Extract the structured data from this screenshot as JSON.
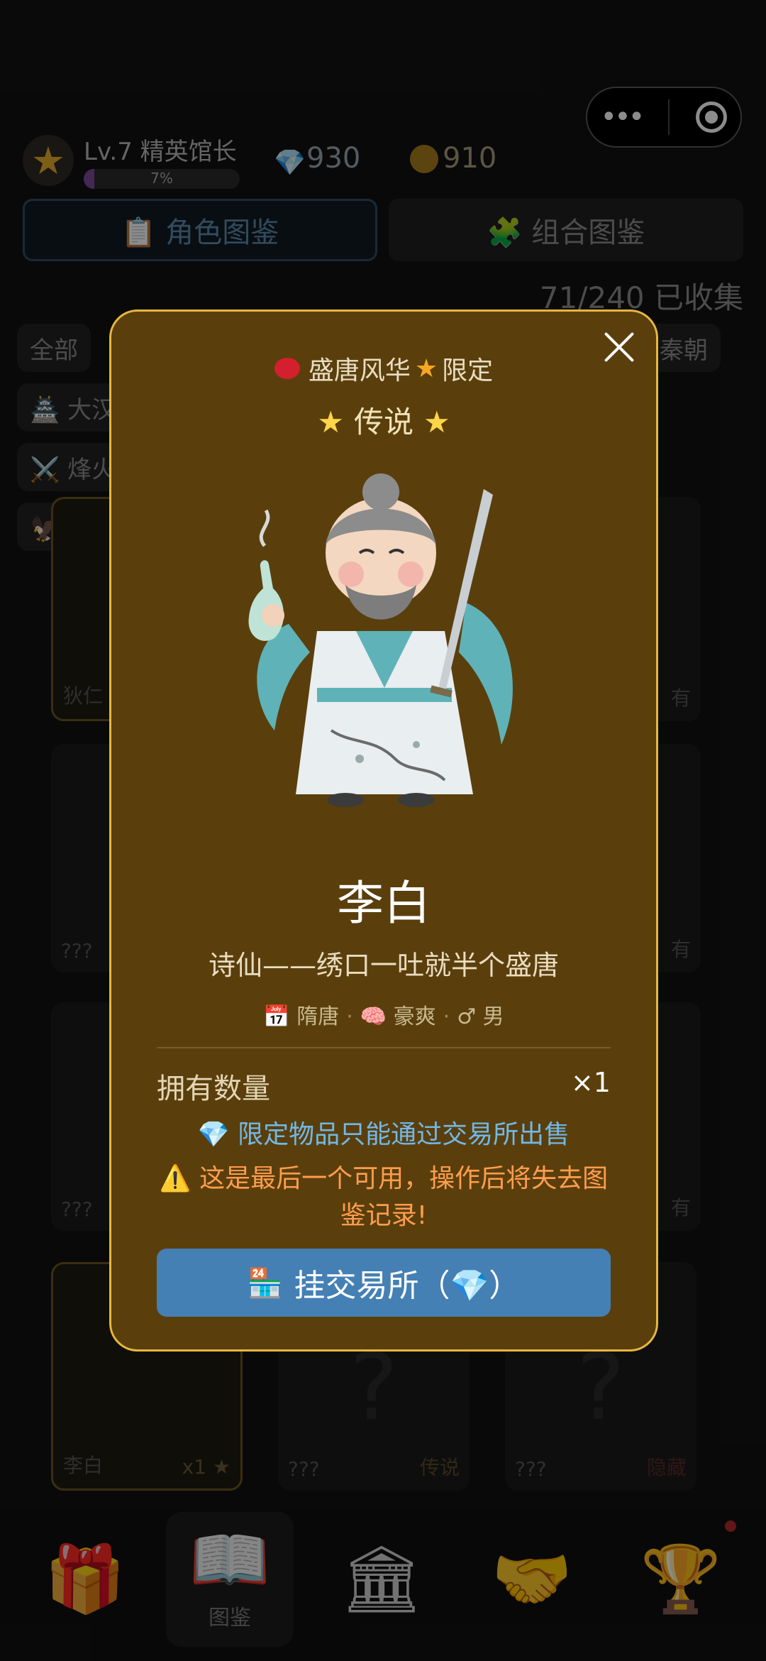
{
  "header": {
    "level_label": "Lv.7 精英馆长",
    "xp_percent": 7,
    "xp_text": "7%",
    "gems": "930",
    "coins": "910"
  },
  "tabs": [
    {
      "label": "📋 角色图鉴",
      "active": true
    },
    {
      "label": "🧩 组合图鉴",
      "active": false
    }
  ],
  "collected": "71/240 已收集",
  "filters": [
    "全部",
    "🏯 大汉",
    "⚔️ 烽火",
    "🦅 枭雄",
    "秦朝"
  ],
  "cards": [
    {
      "label": "狄仁",
      "right": "有"
    },
    {
      "label": "???",
      "right": "有"
    },
    {
      "label": "???",
      "right": "有"
    },
    {
      "label": "李白",
      "right": "x1 ★"
    },
    {
      "label": "???",
      "right": "传说"
    },
    {
      "label": "???",
      "right": "隐藏"
    }
  ],
  "bottom_nav": [
    {
      "icon": "🎁",
      "label": ""
    },
    {
      "icon": "📖",
      "label": "图鉴"
    },
    {
      "icon": "🏛",
      "label": ""
    },
    {
      "icon": "🤝",
      "label": ""
    },
    {
      "icon": "🏆",
      "label": ""
    }
  ],
  "modal": {
    "era_tag": "盛唐风华",
    "limited_tag": "限定",
    "rarity": "传说",
    "name": "李白",
    "motto": "诗仙——绣口一吐就半个盛唐",
    "meta_dynasty": "📅 隋唐",
    "meta_personality": "🧠 豪爽",
    "meta_gender": "♂ 男",
    "owned_label": "拥有数量",
    "owned_value": "×1",
    "limited_note": "💎 限定物品只能通过交易所出售",
    "warning": "⚠️ 这是最后一个可用，操作后将失去图鉴记录!",
    "cta_icon": "🏪",
    "cta_label": "挂交易所（💎）"
  },
  "colors": {
    "modal_bg": "#5a3f0d",
    "modal_border": "#e7b73f",
    "cta_bg": "#4580b4",
    "rarity": "#ffd54a",
    "warning": "#ff9d4d"
  }
}
